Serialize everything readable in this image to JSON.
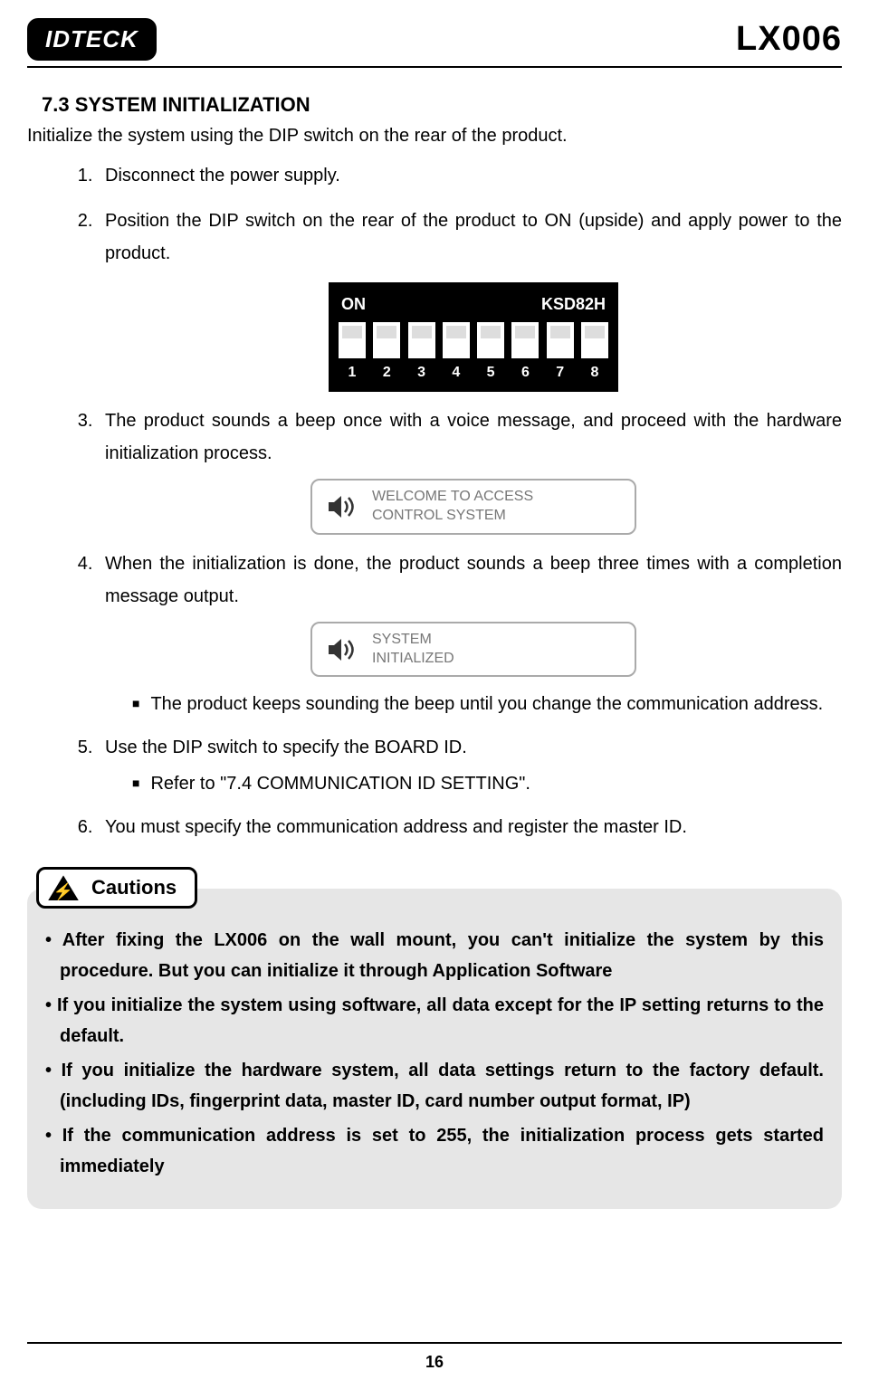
{
  "header": {
    "logo_text": "IDTECK",
    "product_code": "LX006"
  },
  "section": {
    "heading": "7.3 SYSTEM INITIALIZATION",
    "intro": "Initialize the system using the DIP switch on the rear of the product."
  },
  "steps": {
    "s1": "Disconnect the power supply.",
    "s2": "Position the DIP switch on the rear of the product to ON (upside) and apply power to the product.",
    "s3": "The product sounds a beep once with a voice message, and proceed with the hardware initialization process.",
    "s4": "When the initialization is done, the product sounds a beep three times with a completion message output.",
    "s4_bullet": "The product keeps sounding the beep until you change the communication address.",
    "s5": "Use the DIP switch to specify the BOARD ID.",
    "s5_bullet": "Refer to \"7.4 COMMUNICATION ID SETTING\".",
    "s6": "You must specify the communication address and register the master ID."
  },
  "dip": {
    "on_label": "ON",
    "model": "KSD82H",
    "numbers": [
      "1",
      "2",
      "3",
      "4",
      "5",
      "6",
      "7",
      "8"
    ]
  },
  "messages": {
    "welcome_l1": "WELCOME TO ACCESS",
    "welcome_l2": "CONTROL SYSTEM",
    "init_l1": "SYSTEM",
    "init_l2": "INITIALIZED"
  },
  "cautions": {
    "title": "Cautions",
    "items": [
      "• After fixing the LX006 on the wall mount, you can't initialize the system by this procedure. But you can initialize it through Application Software",
      "• If you initialize the system using software, all data except for the IP setting returns to the default.",
      "• If you initialize the hardware system, all data settings return to the factory default. (including IDs, fingerprint data, master ID, card number output format, IP)",
      "• If the communication address is set to 255, the initialization process gets started immediately"
    ]
  },
  "footer": {
    "page_number": "16"
  }
}
